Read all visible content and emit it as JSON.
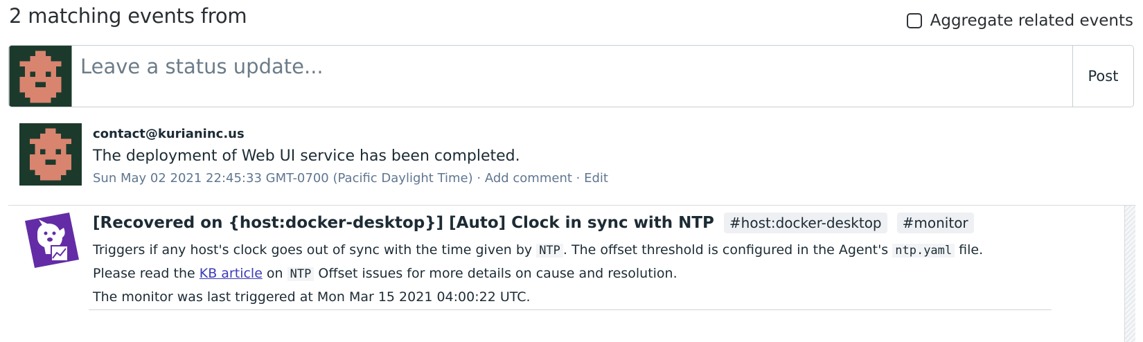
{
  "header": {
    "title": "2 matching events from",
    "aggregate_label": "Aggregate related events",
    "aggregate_checked": false
  },
  "composer": {
    "placeholder": "Leave a status update...",
    "post_label": "Post"
  },
  "events": [
    {
      "author": "contact@kurianinc.us",
      "message": "The deployment of Web UI service has been completed.",
      "timestamp": "Sun May 02 2021 22:45:33 GMT-0700 (Pacific Daylight Time)",
      "separator": " · ",
      "add_comment": "Add comment",
      "edit": "Edit",
      "avatar_icon": "pixel-avatar-icon"
    },
    {
      "title": "[Recovered on {host:docker-desktop}] [Auto] Clock in sync with NTP",
      "tags": [
        "#host:docker-desktop",
        "#monitor"
      ],
      "line1_pre": "Triggers if any host's clock goes out of sync with the time given by ",
      "line1_code1": "NTP",
      "line1_mid": ". The offset threshold is configured in the Agent's ",
      "line1_code2": "ntp.yaml",
      "line1_post": " file.",
      "line2_pre": "Please read the ",
      "line2_link": "KB article",
      "line2_mid": " on ",
      "line2_code": "NTP",
      "line2_post": " Offset issues for more details on cause and resolution.",
      "line3": "The monitor was last triggered at Mon Mar 15 2021 04:00:22 UTC.",
      "source_icon": "datadog-dog-icon"
    }
  ],
  "colors": {
    "avatar_bg": "#1c3a2c",
    "avatar_face": "#d9846f",
    "datadog_purple": "#632ca6",
    "link": "#3d3ab8",
    "meta": "#5f7691"
  }
}
